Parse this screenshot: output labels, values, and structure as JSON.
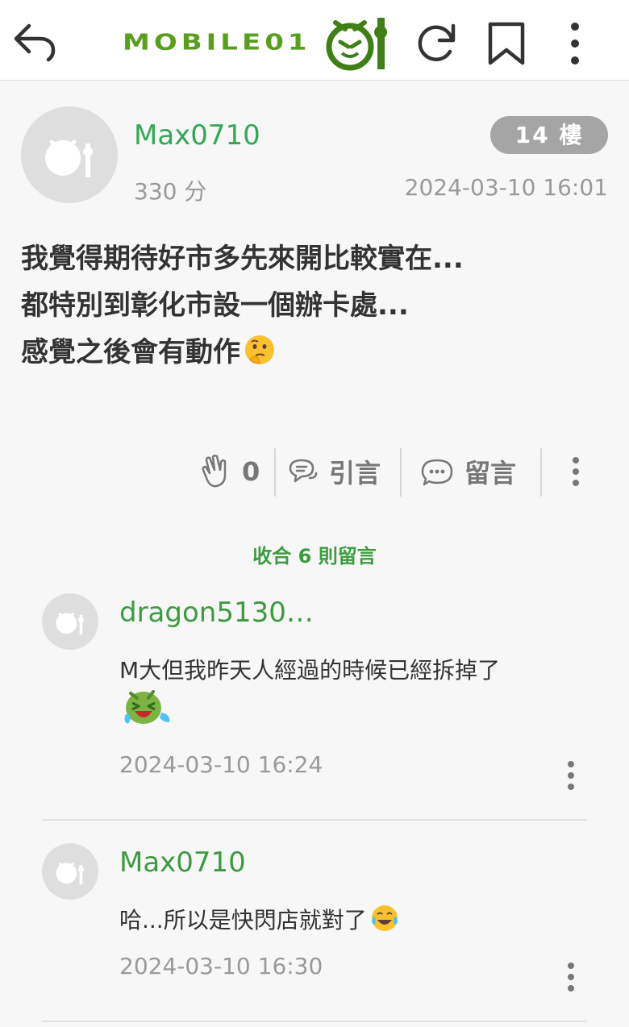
{
  "header": {
    "logo_text": "MOBILE01",
    "brand_color": "#5a9e1e",
    "icons": [
      "back-arrow-icon",
      "reload-icon",
      "bookmark-icon",
      "more-vertical-icon"
    ]
  },
  "post": {
    "author": "Max0710",
    "score": "330 分",
    "floor": "14 樓",
    "time": "2024-03-10 16:01",
    "lines": [
      "我覺得期待好市多先來開比較實在...",
      "都特別到彰化市設一個辦卡處...",
      "感覺之後會有動作"
    ],
    "emoji": "thinking-face",
    "likes": "0",
    "quote_label": "引言",
    "reply_label": "留言"
  },
  "collapse_label": "收合 6 則留言",
  "comments": [
    {
      "author": "dragon5130…",
      "text": "M大但我昨天人經過的時候已經拆掉了",
      "emoji": "laughing-tears-sticker",
      "time": "2024-03-10 16:24"
    },
    {
      "author": "Max0710",
      "text": "哈...所以是快閃店就對了",
      "emoji": "tears-of-joy",
      "time": "2024-03-10 16:30"
    }
  ]
}
